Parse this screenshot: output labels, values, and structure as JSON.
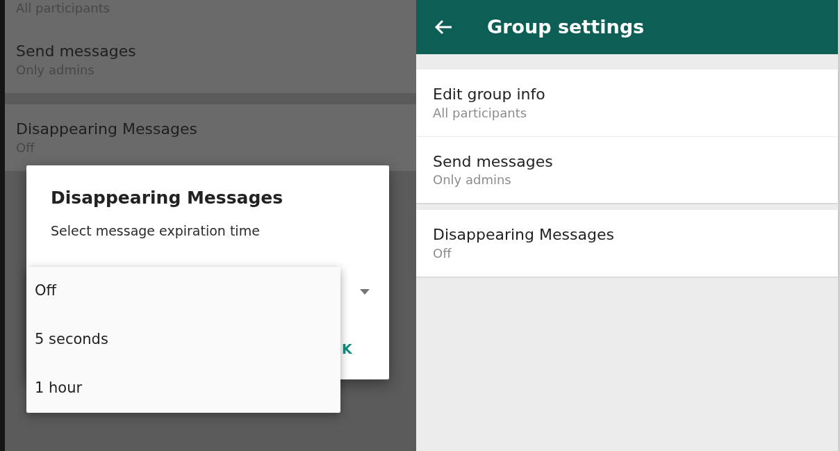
{
  "left_screen": {
    "sections": [
      {
        "items": [
          {
            "subtitle": "All participants"
          },
          {
            "title": "Send messages",
            "subtitle": "Only admins"
          }
        ]
      },
      {
        "items": [
          {
            "title": "Disappearing Messages",
            "subtitle": "Off"
          }
        ]
      }
    ],
    "dialog": {
      "title": "Disappearing Messages",
      "message": "Select message expiration time",
      "ok_button": "K"
    },
    "dropdown_menu": {
      "options": [
        "Off",
        "5 seconds",
        "1 hour"
      ]
    }
  },
  "right_screen": {
    "app_bar": {
      "title": "Group settings"
    },
    "sections": [
      {
        "items": [
          {
            "title": "Edit group info",
            "subtitle": "All participants"
          },
          {
            "title": "Send messages",
            "subtitle": "Only admins"
          }
        ]
      },
      {
        "items": [
          {
            "title": "Disappearing Messages",
            "subtitle": "Off"
          }
        ]
      }
    ]
  }
}
